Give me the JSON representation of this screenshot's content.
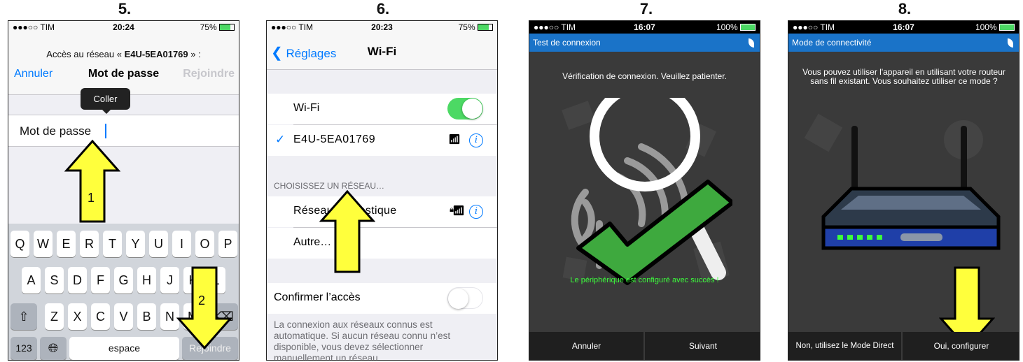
{
  "steps": [
    "5.",
    "6.",
    "7.",
    "8."
  ],
  "phone5": {
    "carrier": "●●●○○ TIM",
    "time": "20:24",
    "battery": "75%",
    "network_prompt_prefix": "Accès au réseau « ",
    "network_prompt_name": "E4U-5EA01769",
    "network_prompt_suffix": " » :",
    "cancel": "Annuler",
    "title": "Mot de passe",
    "join": "Rejoindre",
    "tooltip": "Coller",
    "field_label": "Mot de passe",
    "arrow1": "1",
    "arrow2": "2",
    "row1": [
      "Q",
      "W",
      "E",
      "R",
      "T",
      "Y",
      "U",
      "I",
      "O",
      "P"
    ],
    "row2": [
      "A",
      "S",
      "D",
      "F",
      "G",
      "H",
      "J",
      "K",
      "L"
    ],
    "row3": [
      "Z",
      "X",
      "C",
      "V",
      "B",
      "N",
      "M"
    ],
    "key_123": "123",
    "key_space": "espace",
    "key_join": "Rejoindre"
  },
  "phone6": {
    "carrier": "●●●○○ TIM",
    "time": "20:23",
    "battery": "75%",
    "back": "Réglages",
    "title": "Wi-Fi",
    "wifi_label": "Wi-Fi",
    "connected_network": "E4U-5EA01769",
    "section_header": "CHOISISSEZ UN RÉSEAU…",
    "network_1": "Réseau domestique",
    "other": "Autre…",
    "confirm": "Confirmer l’accès",
    "footer": "La connexion aux réseaux connus est automatique. Si aucun réseau connu n’est disponible, vous devez sélectionner manuellement un réseau."
  },
  "phone7": {
    "carrier": "●●●○○ TIM",
    "time": "16:07",
    "battery": "100%",
    "header": "Test de connexion",
    "message": "Vérification de connexion. Veuillez patienter.",
    "success": "Le périphérique est configuré avec succès !",
    "cancel": "Annuler",
    "next": "Suivant"
  },
  "phone8": {
    "carrier": "●●●○○ TIM",
    "time": "16:07",
    "battery": "100%",
    "header": "Mode de connectivité",
    "message": "Vous pouvez utiliser l'appareil  en utilisant votre routeur sans fil existant. Vous souhaitez utiliser ce mode ?",
    "no": "Non, utilisez le Mode Direct",
    "yes": "Oui, configurer"
  },
  "colors": {
    "ios_blue": "#007aff",
    "toggle_on": "#4cd964",
    "app_blue": "#1a73c8",
    "success_green": "#3cff3c",
    "arrow_yellow": "#ffff3c"
  }
}
